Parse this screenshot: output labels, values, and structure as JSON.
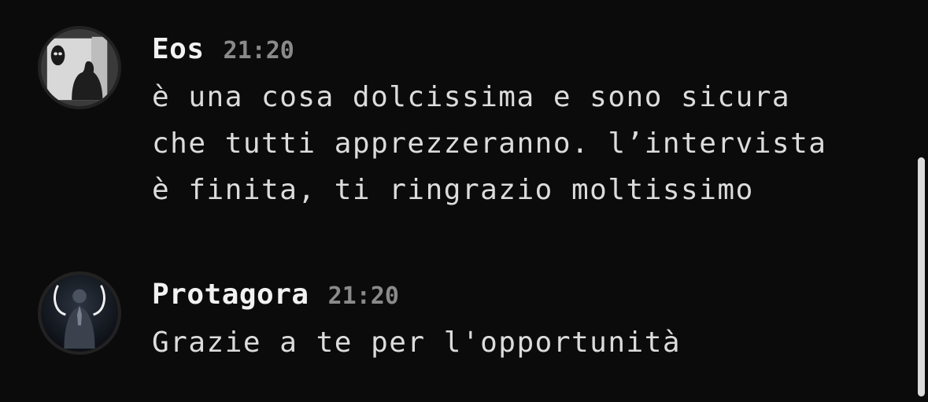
{
  "messages": [
    {
      "username": "Eos",
      "timestamp": "21:20",
      "text": "è una cosa dolcissima e sono sicura\nche tutti apprezzeranno. l’intervista\nè finita, ti ringrazio moltissimo",
      "avatar_icon": "masked-figure-avatar"
    },
    {
      "username": "Protagora",
      "timestamp": "21:20",
      "text": "Grazie a te per l'opportunità",
      "avatar_icon": "praying-figure-avatar"
    }
  ]
}
